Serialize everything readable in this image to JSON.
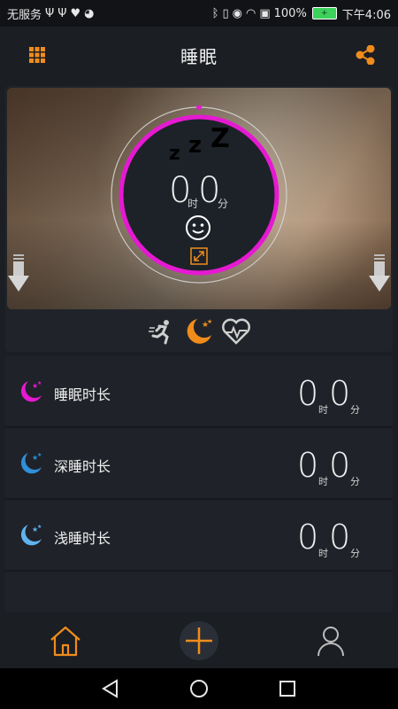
{
  "status_bar": {
    "carrier": "无服务",
    "battery": "100%",
    "time": "下午4:06"
  },
  "app_bar": {
    "title": "睡眠",
    "left_icon": "grid-menu-icon",
    "right_icon": "share-icon"
  },
  "hero": {
    "zzz": [
      "z",
      "z",
      "Z"
    ],
    "hours": "0",
    "hours_unit": "时",
    "minutes": "0",
    "minutes_unit": "分",
    "ring_color": "#e619d2"
  },
  "modes": [
    {
      "name": "run-mode-icon",
      "active": false
    },
    {
      "name": "sleep-mode-icon",
      "active": true
    },
    {
      "name": "heart-mode-icon",
      "active": false
    }
  ],
  "rows": [
    {
      "label": "睡眠时长",
      "hours": "0",
      "hours_unit": "时",
      "minutes": "0",
      "minutes_unit": "分",
      "icon_color": "#e619d2"
    },
    {
      "label": "深睡时长",
      "hours": "0",
      "hours_unit": "时",
      "minutes": "0",
      "minutes_unit": "分",
      "icon_color": "#2f8fd8"
    },
    {
      "label": "浅睡时长",
      "hours": "0",
      "hours_unit": "时",
      "minutes": "0",
      "minutes_unit": "分",
      "icon_color": "#5fb3f0"
    }
  ],
  "accent_color": "#f08c1c",
  "bottom_nav": [
    "home-icon",
    "add-icon",
    "profile-icon"
  ]
}
